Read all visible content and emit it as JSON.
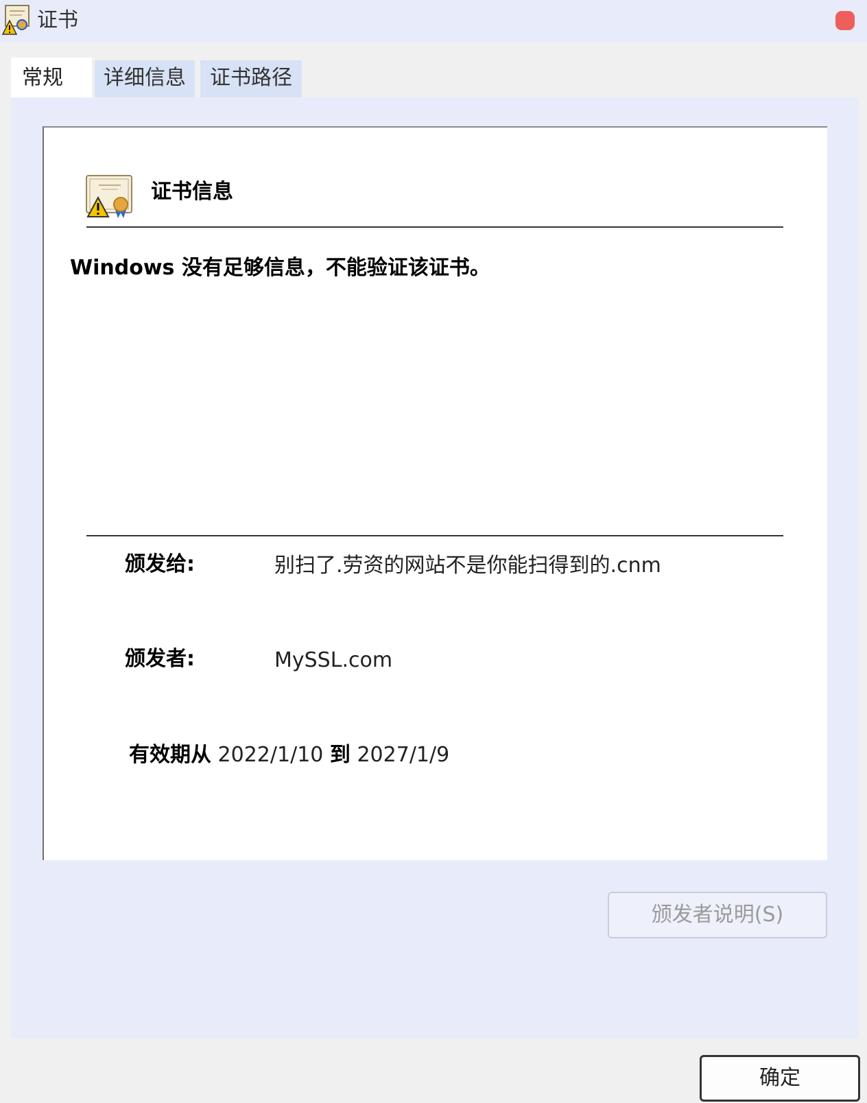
{
  "window": {
    "title": "证书",
    "icon": "certificate-warning-icon"
  },
  "tabs": [
    {
      "label": "常规",
      "active": true
    },
    {
      "label": "详细信息",
      "active": false
    },
    {
      "label": "证书路径",
      "active": false
    }
  ],
  "cert_info": {
    "heading": "证书信息",
    "icon": "certificate-warning-icon",
    "warning_message": "Windows 没有足够信息，不能验证该证书。",
    "issued_to_label": "颁发给:",
    "issued_to_value": "别扫了.劳资的网站不是你能扫得到的.cnm",
    "issued_by_label": "颁发者:",
    "issued_by_value": "MySSL.com",
    "validity_from_label": "有效期从",
    "valid_from": "2022/1/10",
    "validity_to_label": "到",
    "valid_to": "2027/1/9"
  },
  "buttons": {
    "issuer_statement": "颁发者说明(S)",
    "ok": "确定"
  },
  "colors": {
    "close_dot": "#ee5f5b",
    "panel_background": "#e8ecfa",
    "inactive_tab": "#d8e2f6"
  }
}
